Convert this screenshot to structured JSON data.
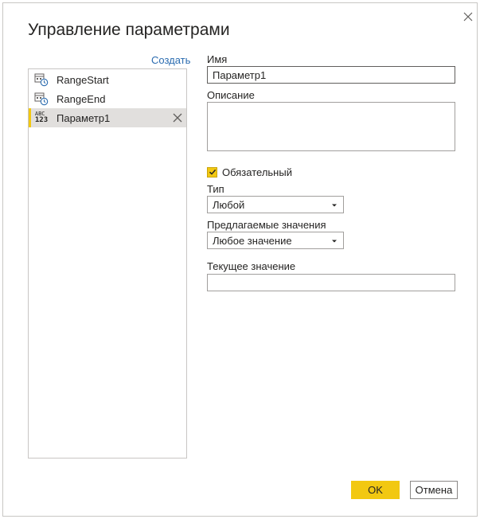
{
  "dialog": {
    "title": "Управление параметрами",
    "close_icon": "close-icon",
    "create_label": "Создать",
    "ok_label": "OK",
    "cancel_label": "Отмена"
  },
  "params": {
    "items": [
      {
        "label": "RangeStart",
        "icon": "datetime-param-icon"
      },
      {
        "label": "RangeEnd",
        "icon": "datetime-param-icon"
      },
      {
        "label": "Параметр1",
        "icon": "text-number-type-icon",
        "icon_text_top": "ABC",
        "icon_text_bottom": "123",
        "selected": true
      }
    ]
  },
  "form": {
    "name_label": "Имя",
    "name_value": "Параметр1",
    "description_label": "Описание",
    "description_value": "",
    "required_label": "Обязательный",
    "required_checked": true,
    "type_label": "Тип",
    "type_value": "Любой",
    "suggested_label": "Предлагаемые значения",
    "suggested_value": "Любое значение",
    "current_label": "Текущее значение",
    "current_value": ""
  },
  "colors": {
    "accent": "#f2c811",
    "link": "#2b6cb0",
    "selected_bg": "#e1dfdd"
  }
}
